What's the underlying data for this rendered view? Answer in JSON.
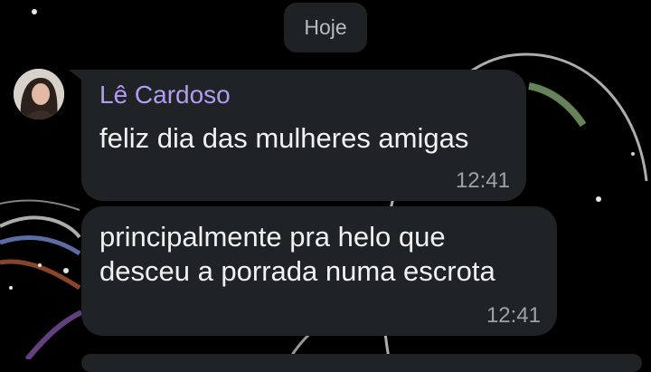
{
  "date_separator": {
    "label": "Hoje"
  },
  "messages": [
    {
      "sender": "Lê Cardoso",
      "text_lines": [
        "feliz dia das mulheres amigas"
      ],
      "time": "12:41"
    },
    {
      "text_lines": [
        "principalmente pra helo que",
        "desceu a porrada numa escrota"
      ],
      "time": "12:41"
    }
  ],
  "colors": {
    "background": "#000000",
    "bubble": "#202325",
    "sender_name": "#b29cf2",
    "timestamp": "#9ea2a5",
    "date_chip": "#1f2224"
  },
  "icons": {
    "avatar": "user-avatar-photo"
  }
}
